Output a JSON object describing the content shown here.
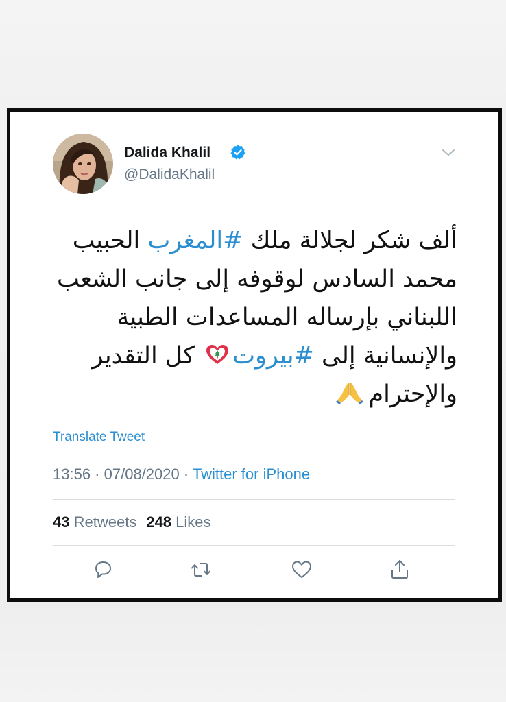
{
  "user": {
    "name": "Dalida Khalil",
    "handle": "@DalidaKhalil",
    "verified": true
  },
  "tweet": {
    "line1_pre": "ألف شكر لجلالة ملك ",
    "line1_tag": "#المغرب",
    "line1_post": " الحبيب",
    "line2": "محمد السادس لوقوفه إلى جانب الشعب",
    "line3": "اللبناني بإرساله المساعدات الطبية",
    "line4_pre": "والإنسانية إلى ",
    "line4_tag": "#بيروت",
    "line4_post": " كل التقدير",
    "line5": "والإحترام",
    "emojis": [
      "lebanon-flag-heart",
      "folded-hands"
    ]
  },
  "translate_label": "Translate Tweet",
  "meta": {
    "time": "13:56",
    "separator": " · ",
    "date": "07/08/2020",
    "source": "Twitter for iPhone"
  },
  "stats": {
    "retweets_count": "43",
    "retweets_label": "Retweets",
    "likes_count": "248",
    "likes_label": "Likes"
  },
  "icons": {
    "reply": "speech-bubble-icon",
    "retweet": "retweet-icon",
    "like": "heart-icon",
    "share": "share-icon",
    "more": "chevron-down-icon"
  },
  "colors": {
    "link": "#2a8ed0",
    "secondary_text": "#657786",
    "primary_text": "#14171a",
    "verified": "#1da1f2",
    "frame_border": "#0d0d0d"
  }
}
